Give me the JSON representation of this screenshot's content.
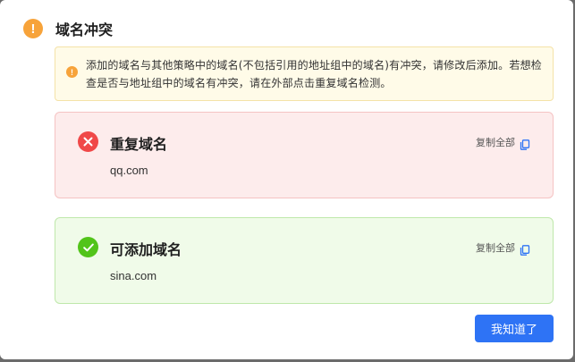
{
  "dialog": {
    "title": "域名冲突",
    "title_icon": "warning-icon",
    "notice": {
      "icon": "warning-icon",
      "text": "添加的域名与其他策略中的域名(不包括引用的地址组中的域名)有冲突，请修改后添加。若想检查是否与地址组中的域名有冲突，请在外部点击重复域名检测。"
    },
    "duplicate_section": {
      "icon": "error-circle-icon",
      "title": "重复域名",
      "copy_label": "复制全部",
      "copy_icon": "copy-icon",
      "value": "qq.com"
    },
    "addable_section": {
      "icon": "check-circle-icon",
      "title": "可添加域名",
      "copy_label": "复制全部",
      "copy_icon": "copy-icon",
      "value": "sina.com"
    },
    "confirm_label": "我知道了"
  },
  "colors": {
    "accent": "#2e73f5",
    "warning": "#f7a33a",
    "error": "#f04848",
    "success": "#52c41a"
  }
}
